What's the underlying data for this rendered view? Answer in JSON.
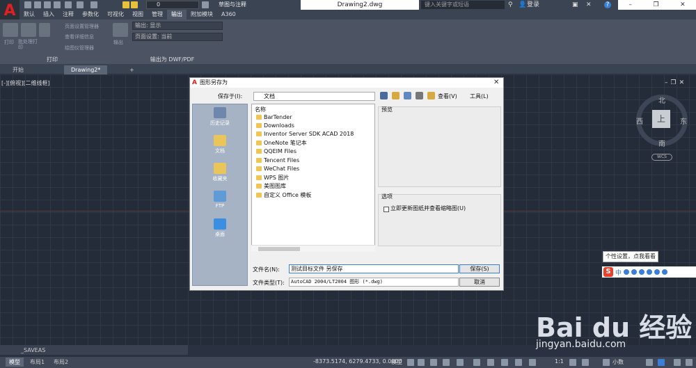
{
  "titlebar": {
    "layer_value": "0",
    "workspace": "草图与注释",
    "document_title": "Drawing2.dwg",
    "search_placeholder": "键入关键字或短语",
    "login": "登录"
  },
  "ribbon_tabs": [
    "默认",
    "插入",
    "注释",
    "参数化",
    "可视化",
    "视图",
    "管理",
    "输出",
    "附加模块",
    "A360"
  ],
  "active_ribbon_tab": "输出",
  "ribbon": {
    "print_panel": {
      "title": "打印",
      "plot_label": "打印",
      "batch_label": "批处理打印",
      "page_setup_manager": "页面设置管理器",
      "view_details": "查看详细信息",
      "plotter_manager": "绘图仪管理器"
    },
    "export_panel": {
      "title": "输出为 DWF/PDF",
      "output_label": "输出",
      "output_display": "输出: 显示",
      "page_setup_current": "页面设置: 当前"
    }
  },
  "doc_tabs": [
    "开始",
    "Drawing2*"
  ],
  "active_doc_tab": "Drawing2*",
  "viewport_label": "[-][俯视][二维线框]",
  "viewcube": {
    "top": "上",
    "north": "北",
    "south": "南",
    "east": "东",
    "west": "西",
    "wcs": "WCS"
  },
  "dialog": {
    "title": "图形另存为",
    "save_in_label": "保存于(I):",
    "save_in_value": "文档",
    "view_menu": "查看(V)",
    "tools_menu": "工具(L)",
    "places": [
      "历史记录",
      "文档",
      "收藏夹",
      "FTP",
      "桌面"
    ],
    "name_column": "名称",
    "files": [
      "BarTender",
      "Downloads",
      "Inventor Server SDK ACAD 2018",
      "OneNote 笔记本",
      "QQEIM Files",
      "Tencent Files",
      "WeChat Files",
      "WPS 图片",
      "美图图库",
      "自定义 Office 模板"
    ],
    "preview_label": "预览",
    "options_label": "选项",
    "checkbox_label": "立即更新图纸并查看缩略图(U)",
    "filename_label": "文件名(N):",
    "filename_value": "测试目标文件 另保存",
    "filetype_label": "文件类型(T):",
    "filetype_value": "AutoCAD 2004/LT2004 图形 (*.dwg)",
    "save_button": "保存(S)",
    "cancel_button": "取消"
  },
  "tooltip": "个性设置，点我看看",
  "ime_label": "中",
  "watermark": {
    "brand": "Bai du 经验",
    "url": "jingyan.baidu.com"
  },
  "command_line": "_SAVEAS",
  "statusbar": {
    "layout_tabs": [
      "模型",
      "布局1",
      "布局2"
    ],
    "active_layout_tab": "模型",
    "coordinates": "-8373.5174, 6279.4733, 0.0000",
    "model_label": "模型",
    "scale": "1:1",
    "units": "小数"
  },
  "colors": {
    "accent_red": "#e02020",
    "canvas_bg": "#252c39",
    "dialog_bg": "#f0f0f0",
    "folder": "#f1c453"
  }
}
